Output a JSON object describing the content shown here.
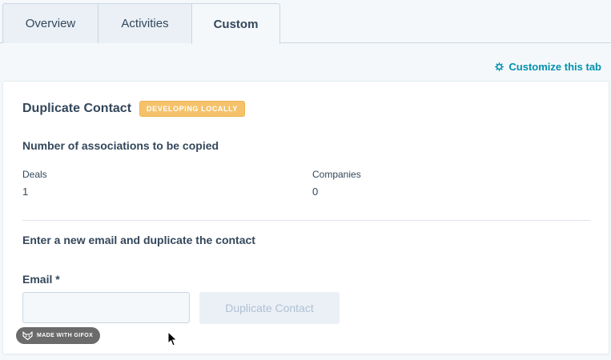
{
  "tabs": [
    {
      "label": "Overview",
      "active": false
    },
    {
      "label": "Activities",
      "active": false
    },
    {
      "label": "Custom",
      "active": true
    }
  ],
  "customize_link": {
    "label": "Customize this tab",
    "icon": "gear-icon"
  },
  "card": {
    "title": "Duplicate Contact",
    "badge": "DEVELOPING LOCALLY",
    "associations_heading": "Number of associations to be copied",
    "stats": [
      {
        "label": "Deals",
        "value": "1"
      },
      {
        "label": "Companies",
        "value": "0"
      }
    ],
    "duplicate_heading": "Enter a new email and duplicate the contact",
    "email_label": "Email *",
    "email_value": "",
    "button_label": "Duplicate Contact"
  },
  "watermark": {
    "label": "MADE WITH GIFOX"
  },
  "colors": {
    "accent": "#0091ae",
    "badge": "#f5c26b",
    "text": "#33475b",
    "tab_bg": "#eaf0f6"
  }
}
